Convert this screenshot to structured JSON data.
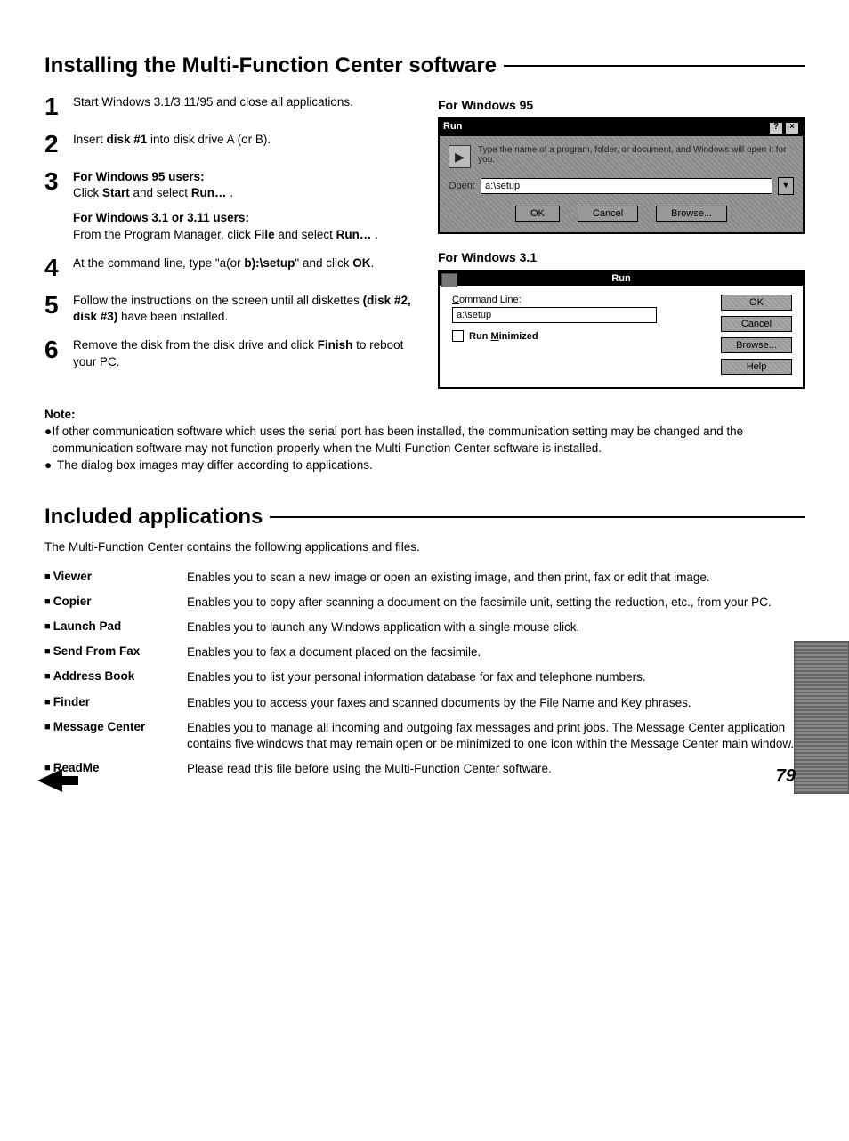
{
  "heading1": "Installing the Multi-Function Center software",
  "steps": {
    "s1": "Start Windows 3.1/3.11/95 and close all applications.",
    "s2_pre": "Insert ",
    "s2_bold": "disk #1",
    "s2_post": " into disk drive A (or B).",
    "s3_h1": "For Windows 95 users:",
    "s3_l1a": "Click ",
    "s3_l1b": "Start",
    "s3_l1c": " and select ",
    "s3_l1d": "Run…",
    "s3_l1e": " .",
    "s3_h2": "For Windows 3.1 or 3.11 users:",
    "s3_l2a": "From the Program Manager, click ",
    "s3_l2b": "File",
    "s3_l2c": " and select ",
    "s3_l2d": "Run…",
    "s3_l2e": " .",
    "s4a": "At the command line, type \"a(or ",
    "s4b": "b):\\setup",
    "s4c": "\" and click ",
    "s4d": "OK",
    "s4e": ".",
    "s5a": "Follow the instructions on the screen until all diskettes ",
    "s5b": "(disk #2, disk #3)",
    "s5c": " have been installed.",
    "s6a": "Remove the disk from the disk drive and click ",
    "s6b": "Finish",
    "s6c": " to reboot your PC."
  },
  "fig95": {
    "label": "For Windows 95",
    "title": "Run",
    "msg": "Type the name of a program, folder, or document, and Windows will open it for you.",
    "open_label": "Open:",
    "open_value": "a:\\setup",
    "btn_ok": "OK",
    "btn_cancel": "Cancel",
    "btn_browse": "Browse..."
  },
  "fig31": {
    "label": "For Windows 3.1",
    "title": "Run",
    "cmd_label_pre": "C",
    "cmd_label_post": "ommand Line:",
    "cmd_value": "a:\\setup",
    "run_min_pre": "Run ",
    "run_min_u": "M",
    "run_min_post": "inimized",
    "btn_ok": "OK",
    "btn_cancel": "Cancel",
    "btn_browse": "Browse...",
    "btn_help": "Help"
  },
  "note": {
    "title": "Note:",
    "item1": "If other communication software which uses the serial port has been installed, the communication setting may be changed and the communication software may not function properly when the Multi-Function Center software is installed.",
    "item2": "The dialog box images may differ according to applications."
  },
  "heading2": "Included applications",
  "intro": "The Multi-Function Center contains the following applications and files.",
  "apps": [
    {
      "name": "Viewer",
      "desc": "Enables you to scan a new image or open an existing image, and then print, fax or edit that image."
    },
    {
      "name": "Copier",
      "desc": "Enables you to copy after scanning a document on the facsimile unit, setting the reduction, etc., from your PC."
    },
    {
      "name": "Launch Pad",
      "desc": "Enables you to launch any Windows application with a single mouse click."
    },
    {
      "name": "Send From Fax",
      "desc": "Enables you to fax a document placed on the facsimile."
    },
    {
      "name": "Address Book",
      "desc": "Enables you to list your personal information database for fax and telephone numbers."
    },
    {
      "name": "Finder",
      "desc": "Enables you to access your faxes and scanned documents by the File Name and Key phrases."
    },
    {
      "name": "Message Center",
      "desc": "Enables you to manage all incoming and outgoing fax messages and print jobs. The Message Center application contains five windows that may remain open or be minimized to one icon within the Message Center main window."
    },
    {
      "name": "ReadMe",
      "desc": "Please read this file before using the Multi-Function Center software."
    }
  ],
  "page_number": "79"
}
